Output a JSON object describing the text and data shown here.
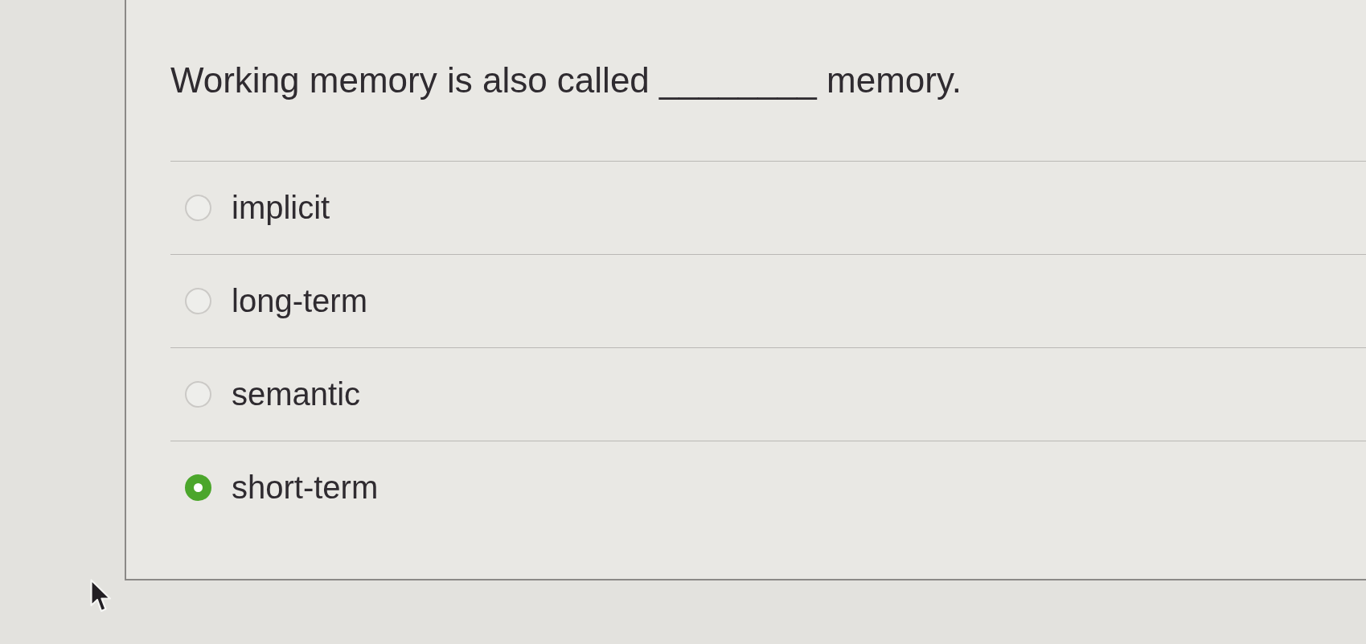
{
  "question": {
    "text": "Working memory is also called ________ memory."
  },
  "options": [
    {
      "label": "implicit",
      "selected": false
    },
    {
      "label": "long-term",
      "selected": false
    },
    {
      "label": "semantic",
      "selected": false
    },
    {
      "label": "short-term",
      "selected": true
    }
  ]
}
